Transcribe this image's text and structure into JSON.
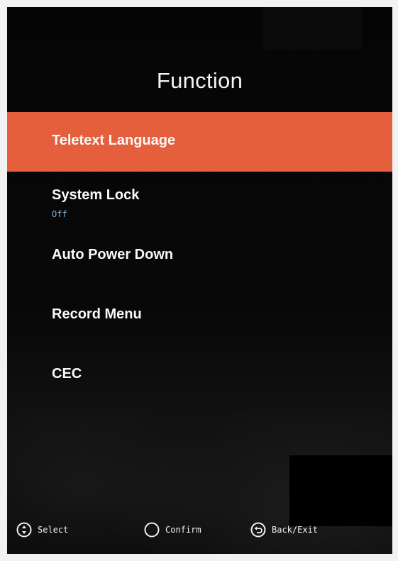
{
  "menu": {
    "title": "Function",
    "items": [
      {
        "label": "Teletext Language",
        "value": "",
        "selected": true
      },
      {
        "label": "System Lock",
        "value": "Off",
        "selected": false
      },
      {
        "label": "Auto Power Down",
        "value": "",
        "selected": false
      },
      {
        "label": "Record Menu",
        "value": "",
        "selected": false
      },
      {
        "label": "CEC",
        "value": "",
        "selected": false
      }
    ]
  },
  "footer": {
    "select_label": "Select",
    "select_icon": "updown-circle-icon",
    "confirm_label": "Confirm",
    "confirm_icon": "circle-icon",
    "back_label": "Back/Exit",
    "back_icon": "return-arrow-icon"
  },
  "colors": {
    "highlight": "#e55f3d",
    "background": "#050505",
    "value_text": "#7fb3d9"
  }
}
